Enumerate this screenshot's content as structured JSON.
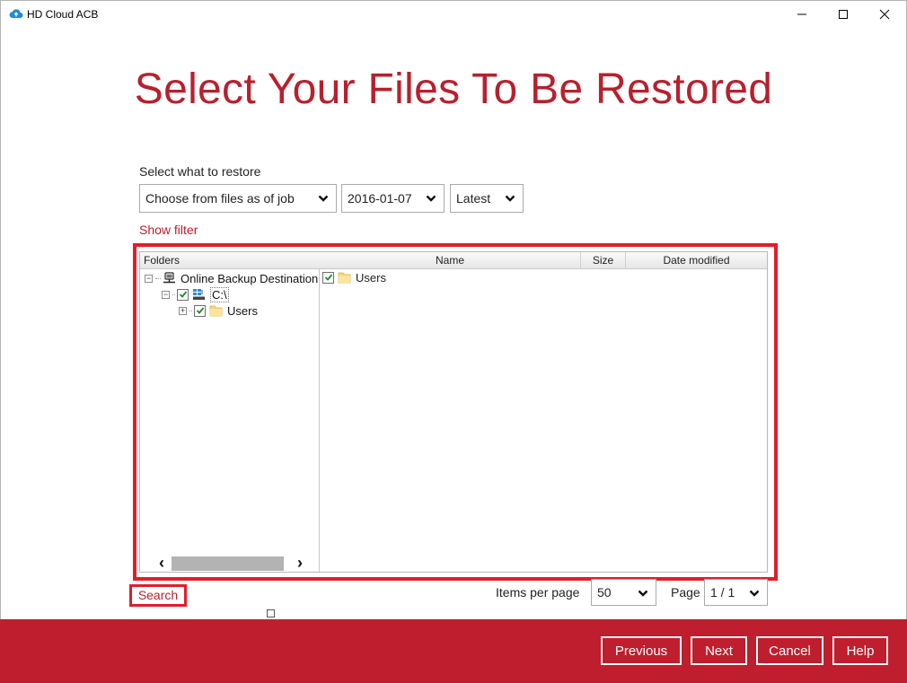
{
  "window": {
    "title": "HD Cloud ACB"
  },
  "page": {
    "title": "Select Your Files To Be Restored",
    "restore_label": "Select what to restore",
    "show_filter": "Show filter"
  },
  "selectors": {
    "restore_mode": "Choose from files as of job",
    "date": "2016-01-07",
    "version": "Latest"
  },
  "file_browser": {
    "folders_header": "Folders",
    "columns": {
      "name": "Name",
      "size": "Size",
      "date_modified": "Date modified"
    },
    "tree": {
      "root": "Online Backup Destination",
      "drive": "C:\\",
      "folder": "Users"
    },
    "list_items": [
      {
        "name": "Users",
        "checked": true
      }
    ]
  },
  "search": "Search",
  "pagination": {
    "items_per_page_label": "Items per page",
    "items_per_page": "50",
    "page_label": "Page",
    "page": "1 / 1"
  },
  "footer": {
    "previous": "Previous",
    "next": "Next",
    "cancel": "Cancel",
    "help": "Help"
  },
  "colors": {
    "accent": "#be1e2d",
    "title_red": "#b8202e",
    "highlight": "#e01e2a"
  }
}
